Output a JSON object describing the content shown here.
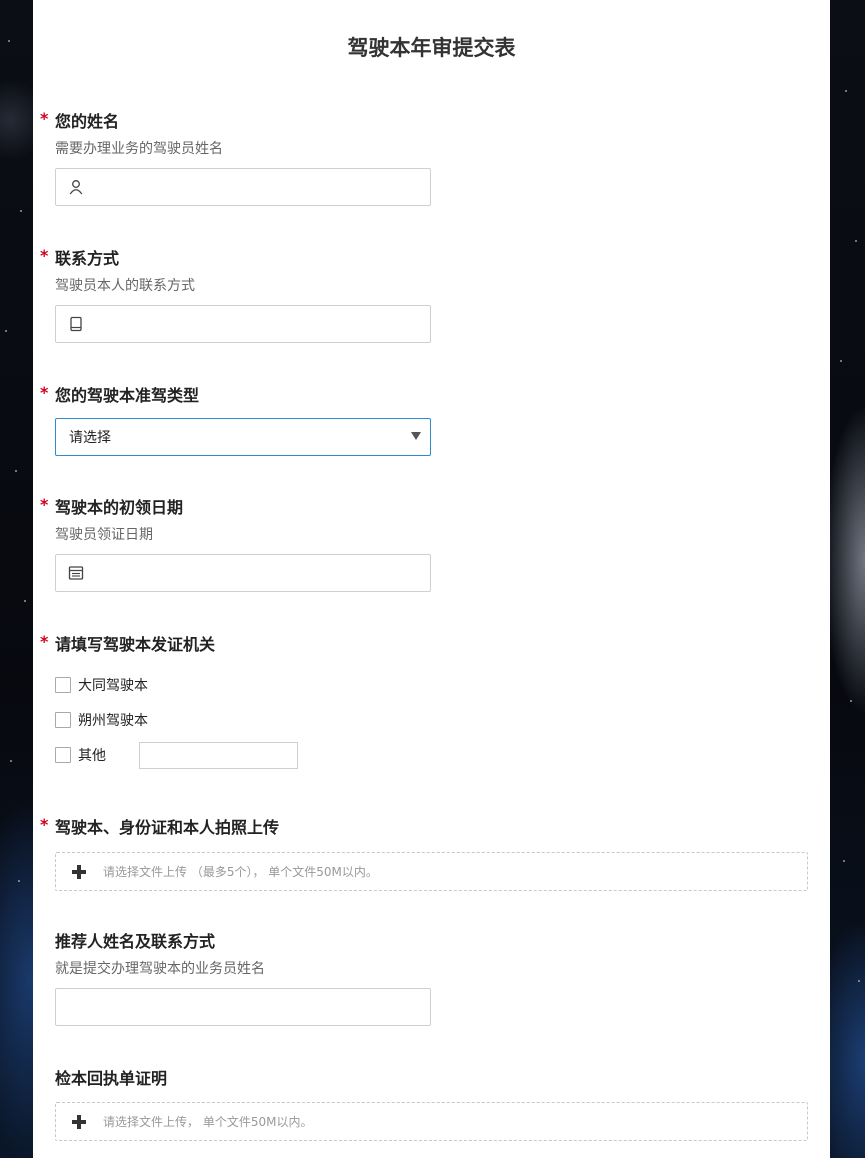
{
  "form": {
    "title": "驾驶本年审提交表",
    "required_mark": "*",
    "fields": {
      "name": {
        "label": "您的姓名",
        "desc": "需要办理业务的驾驶员姓名",
        "icon": "user-icon",
        "value": ""
      },
      "contact": {
        "label": "联系方式",
        "desc": "驾驶员本人的联系方式",
        "icon": "phone-icon",
        "value": ""
      },
      "license_type": {
        "label": "您的驾驶本准驾类型",
        "selected": "请选择"
      },
      "first_date": {
        "label": "驾驶本的初领日期",
        "desc": "驾驶员领证日期",
        "icon": "calendar-icon",
        "value": ""
      },
      "authority": {
        "label": "请填写驾驶本发证机关",
        "options": [
          "大同驾驶本",
          "朔州驾驶本",
          "其他"
        ],
        "other_value": ""
      },
      "photo_upload": {
        "label": "驾驶本、身份证和本人拍照上传",
        "hint": "请选择文件上传 （最多5个），  单个文件50M以内。"
      },
      "referrer": {
        "label": "推荐人姓名及联系方式",
        "desc": "就是提交办理驾驶本的业务员姓名",
        "value": ""
      },
      "receipt_upload": {
        "label": "检本回执单证明",
        "hint": "请选择文件上传，  单个文件50M以内。"
      }
    }
  }
}
